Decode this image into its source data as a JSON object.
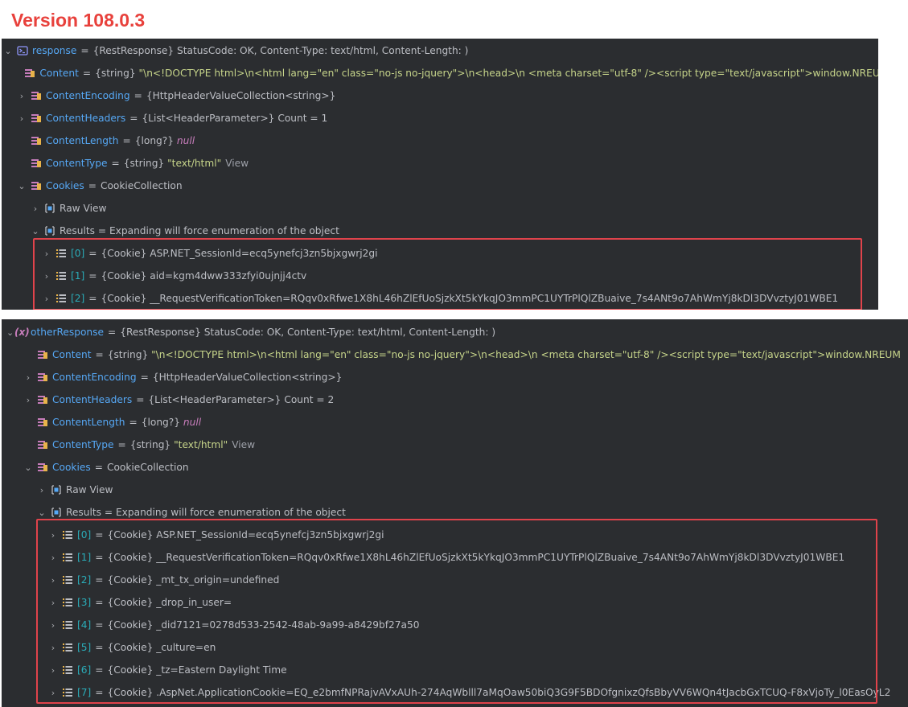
{
  "title": "Version 108.0.3",
  "panel1": {
    "root": {
      "name": "response",
      "value": "{RestResponse} StatusCode: OK, Content-Type: text/html, Content-Length: )"
    },
    "content": {
      "name": "Content",
      "type": "{string}",
      "value": "\"\\n<!DOCTYPE html>\\n<html lang=\"en\" class=\"no-js no-jquery\">\\n<head>\\n    <meta charset=\"utf-8\" /><script type=\"text/javascript\">window.NREUM"
    },
    "encoding": {
      "name": "ContentEncoding",
      "value": "{HttpHeaderValueCollection<string>}"
    },
    "headers": {
      "name": "ContentHeaders",
      "value": "{List<HeaderParameter>} Count = 1"
    },
    "length": {
      "name": "ContentLength",
      "type": "{long?}",
      "value": "null"
    },
    "ctype": {
      "name": "ContentType",
      "type": "{string}",
      "value": "\"text/html\"",
      "link": "View"
    },
    "cookies": {
      "name": "Cookies",
      "value": "CookieCollection"
    },
    "raw_view": "Raw View",
    "results": "Results = Expanding will force enumeration of the object",
    "items": [
      {
        "index": "[0]",
        "value": "{Cookie} ASP.NET_SessionId=ecq5ynefcj3zn5bjxgwrj2gi"
      },
      {
        "index": "[1]",
        "value": "{Cookie} aid=kgm4dww333zfyi0ujnjj4ctv"
      },
      {
        "index": "[2]",
        "value": "{Cookie} __RequestVerificationToken=RQqv0xRfwe1X8hL46hZlEfUoSjzkXt5kYkqJO3mmPC1UYTrPlQlZBuaive_7s4ANt9o7AhWmYj8kDl3DVvztyJ01WBE1"
      }
    ]
  },
  "panel2": {
    "root": {
      "name": "otherResponse",
      "value": "{RestResponse} StatusCode: OK, Content-Type: text/html, Content-Length: )"
    },
    "root_icon": "(x)",
    "content": {
      "name": "Content",
      "type": "{string}",
      "value": "\"\\n<!DOCTYPE html>\\n<html lang=\"en\" class=\"no-js no-jquery\">\\n<head>\\n    <meta charset=\"utf-8\" /><script type=\"text/javascript\">window.NREUM"
    },
    "encoding": {
      "name": "ContentEncoding",
      "value": "{HttpHeaderValueCollection<string>}"
    },
    "headers": {
      "name": "ContentHeaders",
      "value": "{List<HeaderParameter>} Count = 2"
    },
    "length": {
      "name": "ContentLength",
      "type": "{long?}",
      "value": "null"
    },
    "ctype": {
      "name": "ContentType",
      "type": "{string}",
      "value": "\"text/html\"",
      "link": "View"
    },
    "cookies": {
      "name": "Cookies",
      "value": "CookieCollection"
    },
    "raw_view": "Raw View",
    "results": "Results = Expanding will force enumeration of the object",
    "items": [
      {
        "index": "[0]",
        "value": "{Cookie} ASP.NET_SessionId=ecq5ynefcj3zn5bjxgwrj2gi"
      },
      {
        "index": "[1]",
        "value": "{Cookie} __RequestVerificationToken=RQqv0xRfwe1X8hL46hZlEfUoSjzkXt5kYkqJO3mmPC1UYTrPlQlZBuaive_7s4ANt9o7AhWmYj8kDl3DVvztyJ01WBE1"
      },
      {
        "index": "[2]",
        "value": "{Cookie} _mt_tx_origin=undefined"
      },
      {
        "index": "[3]",
        "value": "{Cookie} _drop_in_user="
      },
      {
        "index": "[4]",
        "value": "{Cookie} _did7121=0278d533-2542-48ab-9a99-a8429bf27a50"
      },
      {
        "index": "[5]",
        "value": "{Cookie} _culture=en"
      },
      {
        "index": "[6]",
        "value": "{Cookie} _tz=Eastern Daylight Time"
      },
      {
        "index": "[7]",
        "value": "{Cookie} .AspNet.ApplicationCookie=EQ_e2bmfNPRajvAVxAUh-274AqWblll7aMqOaw50biQ3G9F5BDOfgnixzQfsBbyVV6WQn4tJacbGxTCUQ-F8xVjoTy_l0EasOyL2"
      }
    ]
  },
  "icons": {
    "field": "field-icon",
    "method": "method-icon",
    "list": "list-icon",
    "console": "console-icon",
    "variable": "variable-icon"
  },
  "colors": {
    "panel_bg": "#2b2d30",
    "name": "#56a8f5",
    "string": "#c6d48a",
    "keyword": "#c77dbb",
    "index": "#2aacb8",
    "highlight": "#e0434b",
    "title": "#e8413c"
  }
}
